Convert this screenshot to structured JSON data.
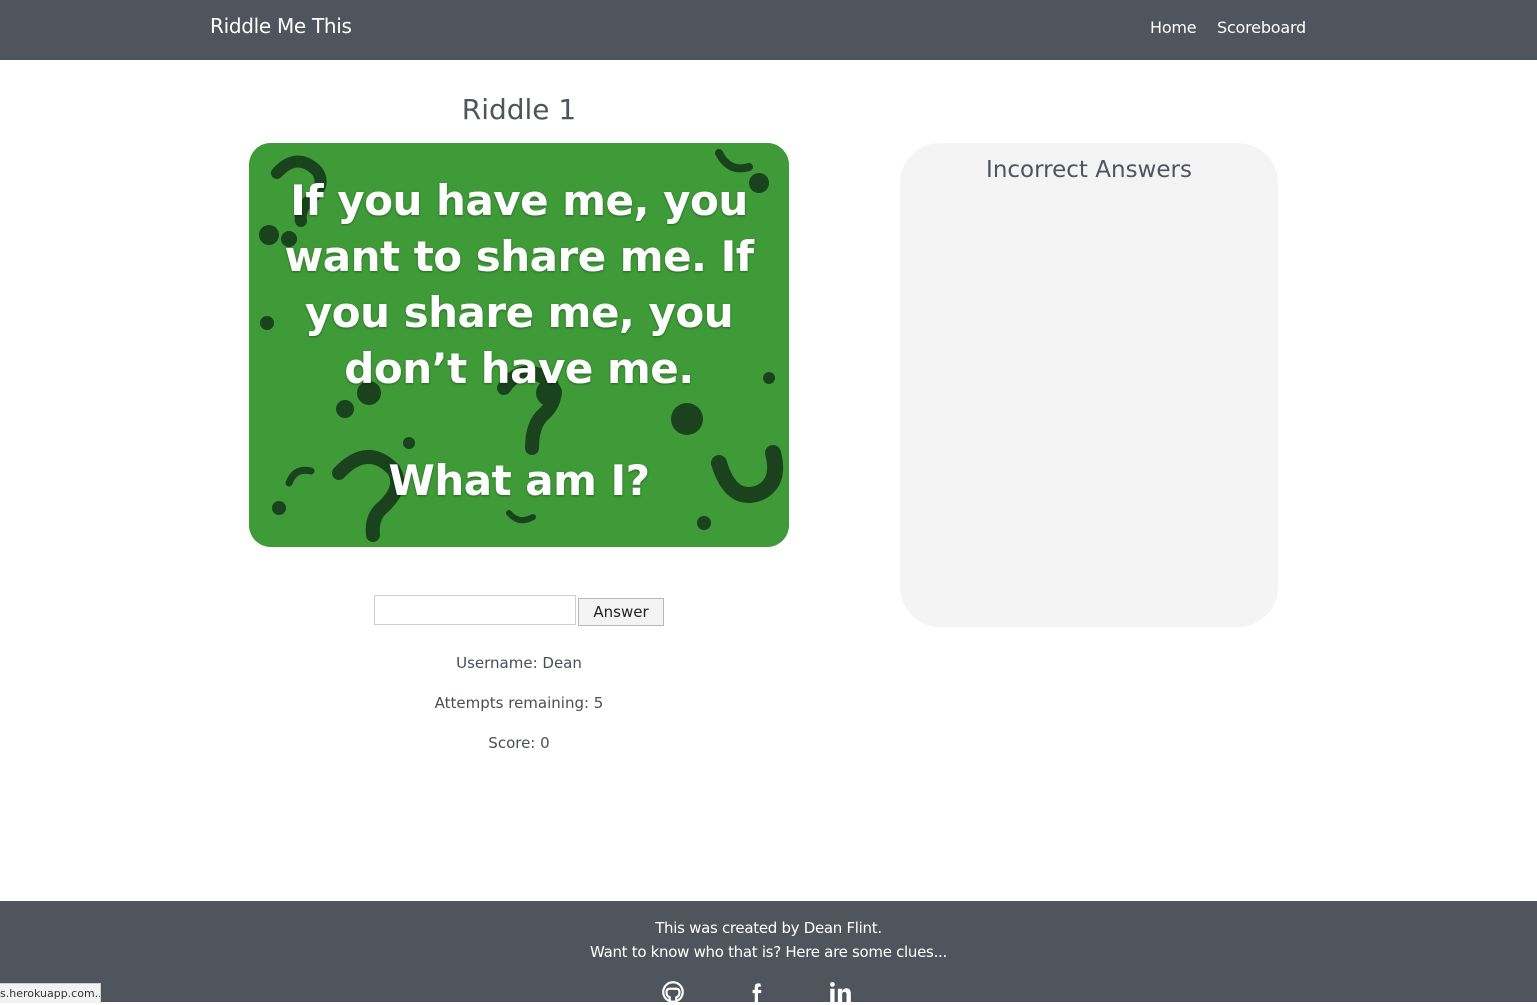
{
  "navbar": {
    "brand": "Riddle Me This",
    "links": [
      "Home",
      "Scoreboard"
    ]
  },
  "riddle": {
    "title": "Riddle 1",
    "image_text": "If you have me, you want to share me. If you share me, you don’t have me.",
    "image_question": "What am I?"
  },
  "form": {
    "input_value": "",
    "button_label": "Answer"
  },
  "stats": {
    "username": "Username: Dean",
    "attempts": "Attempts remaining: 5",
    "score": "Score: 0"
  },
  "incorrect": {
    "title": "Incorrect Answers",
    "items": []
  },
  "footer": {
    "line1": "This was created by Dean Flint.",
    "line2": "Want to know who that is? Here are some clues...",
    "icons": [
      "github-icon",
      "facebook-icon",
      "linkedin-icon"
    ]
  },
  "status_bar": {
    "url": "s.herokuapp.com..."
  },
  "colors": {
    "navbar": "#50545c",
    "riddle_green": "#3f9a38",
    "panel": "#f4f4f4"
  }
}
